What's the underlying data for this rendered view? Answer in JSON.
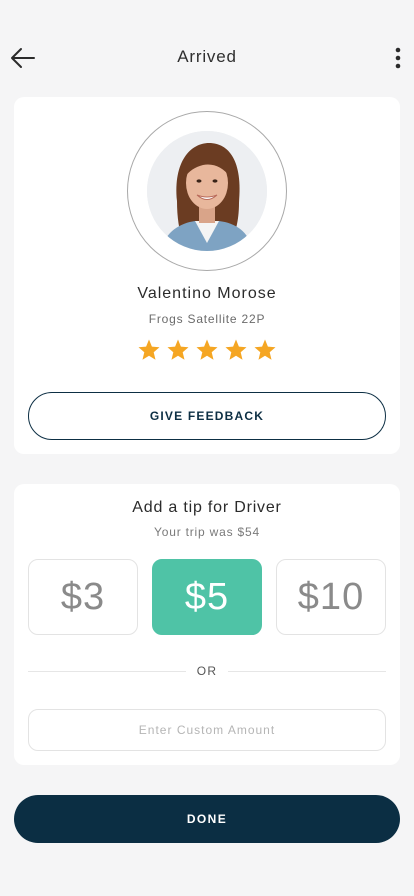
{
  "header": {
    "title": "Arrived",
    "back_icon": "arrow-left-icon",
    "more_icon": "more-vertical-icon"
  },
  "driver": {
    "name": "Valentino Morose",
    "car": "Frogs Satellite 22P",
    "rating": 5,
    "max_rating": 5,
    "feedback_label": "GIVE FEEDBACK"
  },
  "tip": {
    "title": "Add a tip for Driver",
    "subtitle": "Your trip was $54",
    "options": [
      {
        "label": "$3",
        "selected": false
      },
      {
        "label": "$5",
        "selected": true
      },
      {
        "label": "$10",
        "selected": false
      }
    ],
    "or_label": "OR",
    "custom_placeholder": "Enter Custom Amount",
    "custom_value": ""
  },
  "done_label": "DONE",
  "colors": {
    "background": "#f5f5f6",
    "primary_dark": "#0b2e43",
    "accent_green": "#4fc3a6",
    "star": "#f5a623"
  }
}
